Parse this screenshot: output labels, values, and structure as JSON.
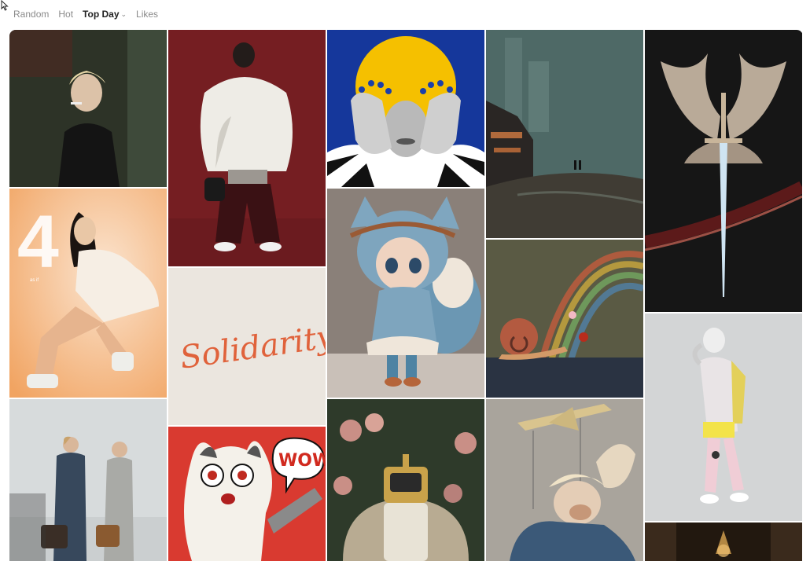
{
  "tabs": [
    {
      "label": "Random",
      "active": false
    },
    {
      "label": "Hot",
      "active": false
    },
    {
      "label": "Top Day",
      "active": true,
      "has_dropdown": true
    },
    {
      "label": "Likes",
      "active": false
    }
  ],
  "icons": {
    "cursor": "arrow-cursor-icon",
    "dropdown": "chevron-down-icon"
  },
  "artworks": {
    "solidarity_text": "Solidarity",
    "wow_text": "WOW",
    "poster_number": "4",
    "poster_caption": "as if"
  },
  "colors": {
    "active_tab": "#222222",
    "inactive_tab": "#8a8a8a"
  }
}
